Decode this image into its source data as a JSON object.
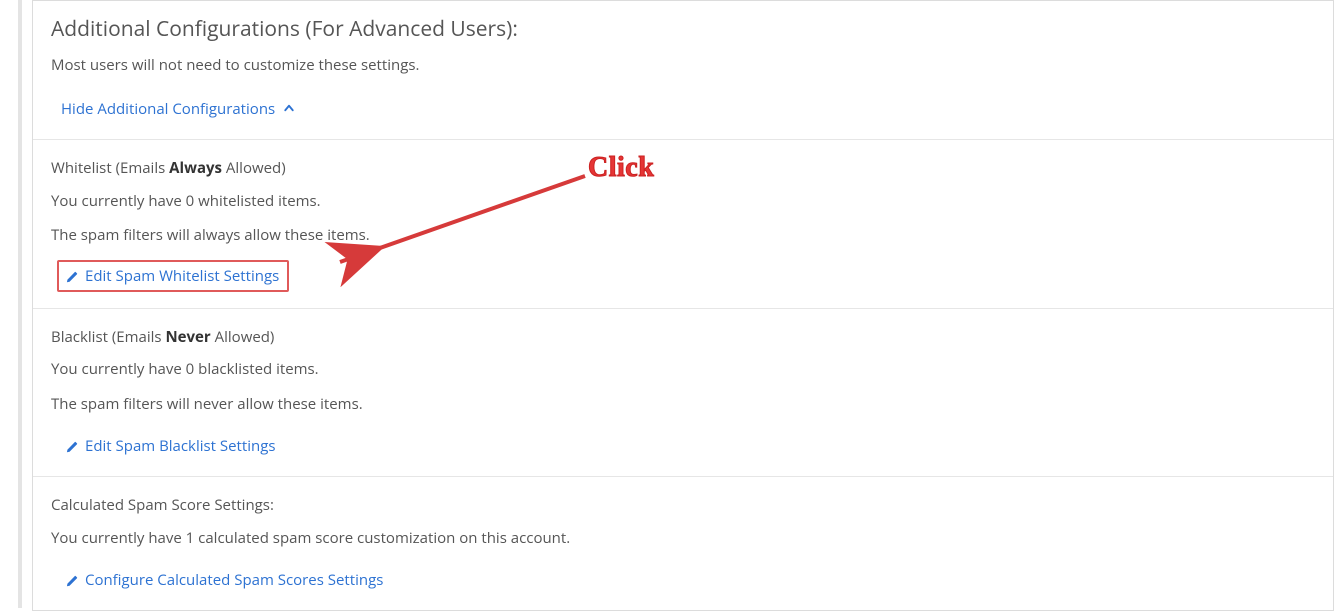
{
  "header": {
    "title": "Additional Configurations (For Advanced Users):",
    "subtitle": "Most users will not need to customize these settings.",
    "toggle_label": "Hide Additional Configurations"
  },
  "whitelist": {
    "title_prefix": "Whitelist (Emails ",
    "title_bold": "Always",
    "title_suffix": " Allowed)",
    "count_line": "You currently have 0 whitelisted items.",
    "desc_line": "The spam filters will always allow these items.",
    "button_label": "Edit Spam Whitelist Settings"
  },
  "blacklist": {
    "title_prefix": "Blacklist (Emails ",
    "title_bold": "Never",
    "title_suffix": " Allowed)",
    "count_line": "You currently have 0 blacklisted items.",
    "desc_line": "The spam filters will never allow these items.",
    "button_label": "Edit Spam Blacklist Settings"
  },
  "scores": {
    "title": "Calculated Spam Score Settings:",
    "count_line": "You currently have 1 calculated spam score customization on this account.",
    "button_label": "Configure Calculated Spam Scores Settings"
  },
  "annotation": {
    "label": "Click"
  },
  "colors": {
    "link": "#2d72d2",
    "highlight": "#e05a5a",
    "annotation": "#e53535"
  }
}
